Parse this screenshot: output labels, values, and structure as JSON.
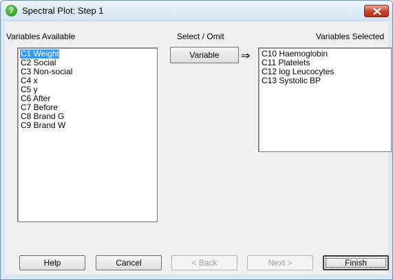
{
  "window": {
    "title": "Spectral Plot: Step 1",
    "title_icon": "help-question-icon",
    "title_icon_glyph": "?",
    "close_icon": "close-icon"
  },
  "labels": {
    "available": "Variables Available",
    "select_omit": "Select / Omit",
    "selected": "Variables Selected"
  },
  "variable_button": "Variable",
  "transfer_arrow": "⇒",
  "available_list": {
    "items": [
      "C1 Weight",
      "C2 Social",
      "C3 Non-social",
      "C4 x",
      "C5 y",
      "C6 After",
      "C7 Before",
      "C8 Brand G",
      "C9 Brand W"
    ],
    "selected_index": 0
  },
  "selected_list": {
    "items": [
      "C10 Haemoglobin",
      "C11 Platelets",
      "C12 log Leucocytes",
      "C13 Systolic BP"
    ]
  },
  "buttons": {
    "help": "Help",
    "cancel": "Cancel",
    "back": "< Back",
    "next": "Next >",
    "finish": "Finish"
  },
  "colors": {
    "selection": "#3399ff",
    "close_button": "#c8412a"
  }
}
